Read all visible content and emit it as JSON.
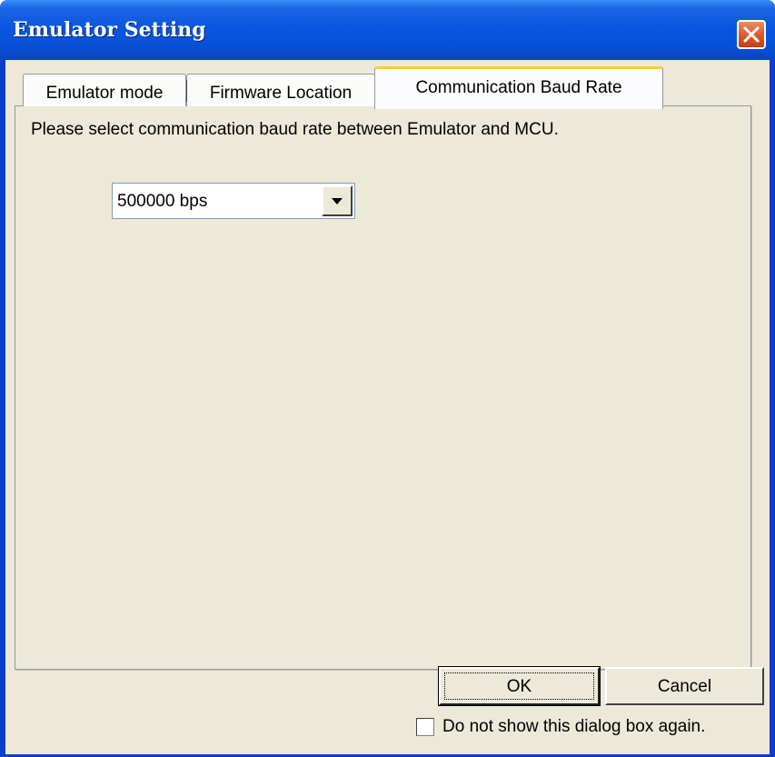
{
  "window": {
    "title": "Emulator Setting"
  },
  "tabs": [
    {
      "label": "Emulator mode",
      "active": false
    },
    {
      "label": "Firmware Location",
      "active": false
    },
    {
      "label": "Communication Baud Rate",
      "active": true
    }
  ],
  "panel": {
    "instruction": "Please select communication baud rate between Emulator and MCU.",
    "baud_rate": {
      "selected": "500000 bps"
    }
  },
  "buttons": {
    "ok_label": "OK",
    "cancel_label": "Cancel"
  },
  "footer": {
    "dont_show_label": "Do not show this dialog box again.",
    "dont_show_checked": false
  },
  "colors": {
    "titlebar": "#0a55e0",
    "client": "#ece9d8",
    "active_tab_accent": "#ffc83c",
    "close_button": "#e15a2e"
  }
}
